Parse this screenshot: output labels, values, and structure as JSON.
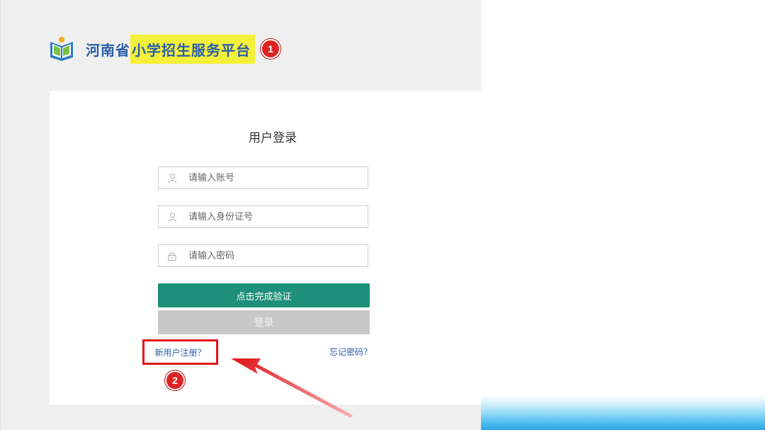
{
  "header": {
    "title_prefix": "河南省",
    "title_highlight": "小学招生服务平台",
    "badge1": "1"
  },
  "login": {
    "title": "用户登录",
    "account_placeholder": "请输入账号",
    "id_placeholder": "请输入身份证号",
    "password_placeholder": "请输入密码",
    "verify_label": "点击完成验证",
    "login_label": "登录",
    "register_link": "新用户注册？",
    "forgot_link": "忘记密码？",
    "badge2": "2"
  },
  "icons": {
    "logo": "book-logo-icon",
    "user": "user-icon",
    "lock": "lock-icon",
    "arrow": "red-arrow-icon"
  },
  "colors": {
    "brand_blue": "#2a5fa8",
    "highlight": "#f4f03a",
    "verify_green": "#1e8f7a",
    "annotation_red": "#e0161b"
  }
}
